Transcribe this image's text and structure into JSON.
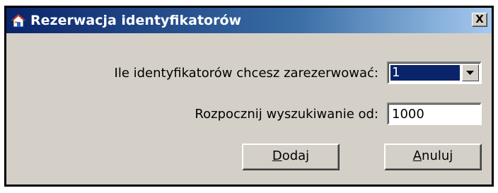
{
  "window": {
    "title": "Rezerwacja identyfikatorów",
    "close_label": "X",
    "icon": "house-icon"
  },
  "form": {
    "count_label": "Ile identyfikatorów chcesz zarezerwować:",
    "count_value": "1",
    "start_label": "Rozpocznij wyszukiwanie od:",
    "start_value": "1000"
  },
  "buttons": {
    "add_accel": "D",
    "add_rest": "odaj",
    "cancel_accel": "A",
    "cancel_rest": "nuluj"
  },
  "colors": {
    "titlebar_start": "#0a246a",
    "titlebar_end": "#a6caf0",
    "dialog_bg": "#d4d0c8",
    "selection_bg": "#0a246a"
  }
}
